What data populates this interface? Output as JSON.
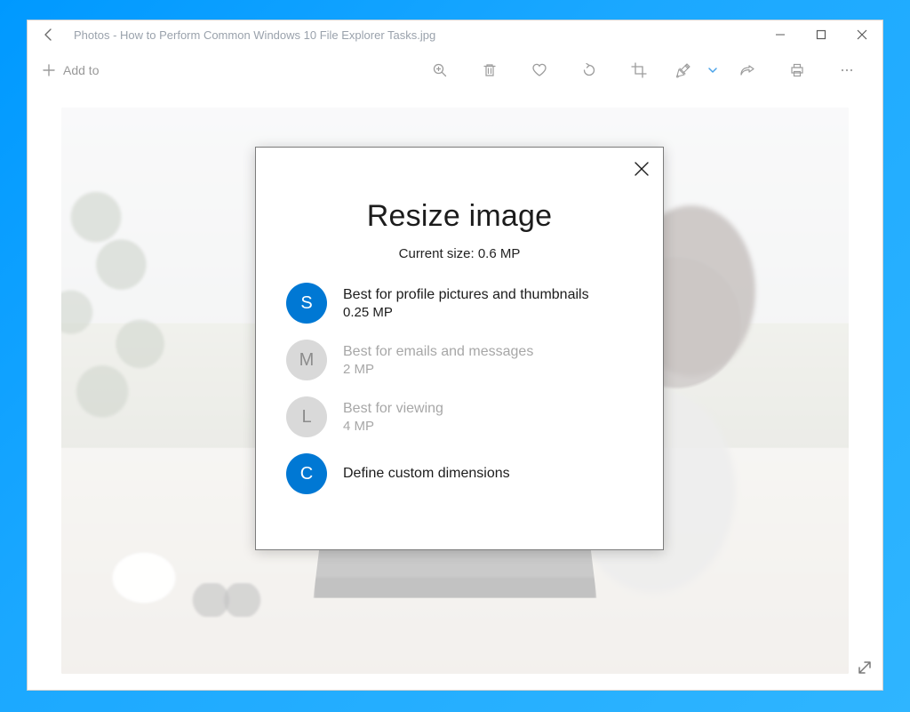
{
  "titlebar": {
    "title": "Photos - How to Perform Common Windows 10 File Explorer Tasks.jpg"
  },
  "toolbar": {
    "addto_label": "Add to"
  },
  "dialog": {
    "title": "Resize image",
    "subtitle": "Current size: 0.6 MP",
    "options": [
      {
        "badge": "S",
        "label": "Best for profile pictures and thumbnails",
        "sub": "0.25 MP",
        "state": "active"
      },
      {
        "badge": "M",
        "label": "Best for emails and messages",
        "sub": "2 MP",
        "state": "disabled"
      },
      {
        "badge": "L",
        "label": "Best for viewing",
        "sub": "4 MP",
        "state": "disabled"
      },
      {
        "badge": "C",
        "label": "Define custom dimensions",
        "sub": "",
        "state": "active"
      }
    ]
  }
}
